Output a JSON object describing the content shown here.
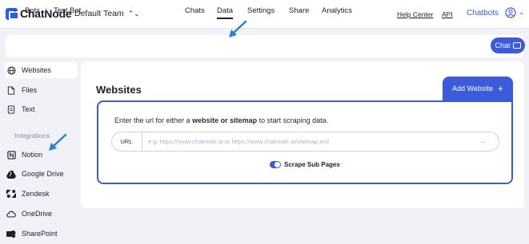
{
  "header": {
    "logo_text": "ChatNode",
    "team": "Default Team",
    "links": [
      "Help Center",
      "API"
    ],
    "chatbots": "Chatbots"
  },
  "subbar": {
    "breadcrumb": [
      "Bots",
      "/",
      "Test Bot"
    ],
    "tabs": [
      "Chats",
      "Data",
      "Settings",
      "Share",
      "Analytics"
    ],
    "active_tab": "Data",
    "chat_button": "Chat"
  },
  "sidebar": {
    "items": [
      "Websites",
      "Files",
      "Text"
    ],
    "section": "Integrations",
    "integrations": [
      "Notion",
      "Google Drive",
      "Zendesk",
      "OneDrive",
      "SharePoint"
    ]
  },
  "main": {
    "title": "Websites",
    "add_button": "Add Website",
    "instruction_pre": "Enter the url for either a ",
    "instruction_bold": "website or sitemap",
    "instruction_post": " to start scraping data.",
    "url_label": "URL",
    "url_placeholder": "e.g. https://www.chatnode.ai or https://www.chatnode.ai/sitemap.xml",
    "toggle_label": "Scrape Sub Pages",
    "toggle_on": true
  },
  "colors": {
    "accent": "#3b5bdb",
    "arrow": "#2b7fd4",
    "background": "#f0f2f8"
  }
}
